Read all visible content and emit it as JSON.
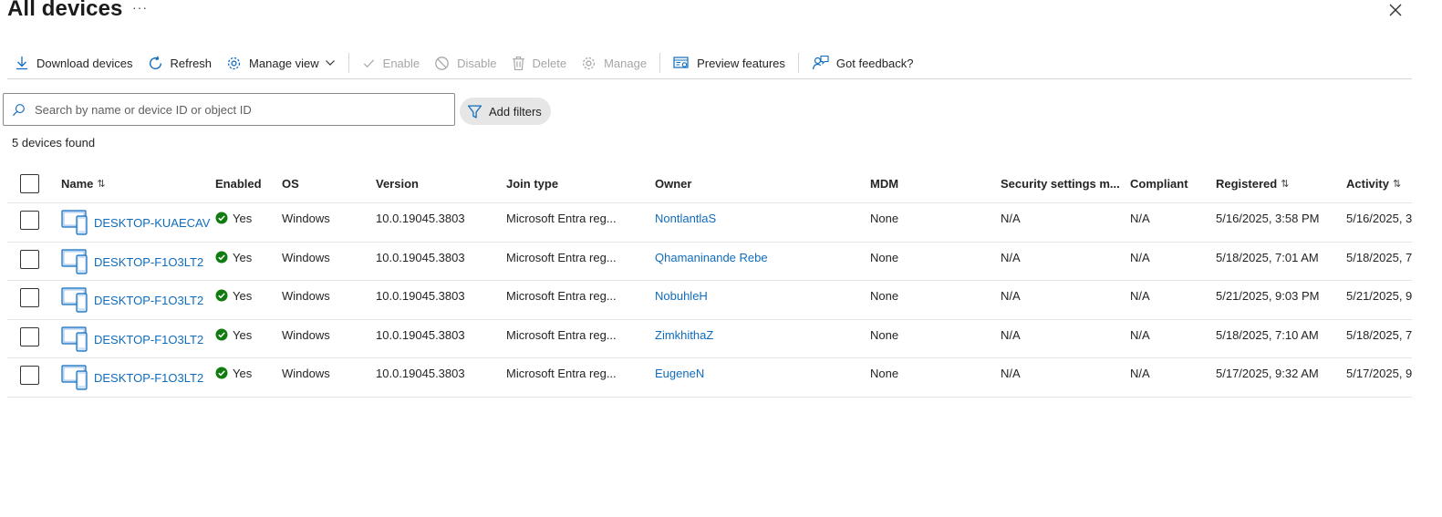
{
  "page": {
    "title": "All devices",
    "more_label": "···"
  },
  "toolbar": {
    "download_label": "Download devices",
    "refresh_label": "Refresh",
    "manage_view_label": "Manage view",
    "enable_label": "Enable",
    "disable_label": "Disable",
    "delete_label": "Delete",
    "manage_label": "Manage",
    "preview_label": "Preview features",
    "feedback_label": "Got feedback?"
  },
  "search": {
    "placeholder": "Search by name or device ID or object ID",
    "value": ""
  },
  "filters": {
    "add_label": "Add filters"
  },
  "results": {
    "count_text": "5 devices found"
  },
  "table": {
    "columns": {
      "name": "Name",
      "enabled": "Enabled",
      "os": "OS",
      "version": "Version",
      "join_type": "Join type",
      "owner": "Owner",
      "mdm": "MDM",
      "security": "Security settings m...",
      "compliant": "Compliant",
      "registered": "Registered",
      "activity": "Activity"
    },
    "sort_glyph": "⇅",
    "rows": [
      {
        "name": "DESKTOP-KUAECAV",
        "enabled": "Yes",
        "os": "Windows",
        "version": "10.0.19045.3803",
        "join_type": "Microsoft Entra reg...",
        "owner": "NontlantlaS",
        "mdm": "None",
        "security": "N/A",
        "compliant": "N/A",
        "registered": "5/16/2025, 3:58 PM",
        "activity": "5/16/2025, 3"
      },
      {
        "name": "DESKTOP-F1O3LT2",
        "enabled": "Yes",
        "os": "Windows",
        "version": "10.0.19045.3803",
        "join_type": "Microsoft Entra reg...",
        "owner": "Qhamaninande Rebe",
        "mdm": "None",
        "security": "N/A",
        "compliant": "N/A",
        "registered": "5/18/2025, 7:01 AM",
        "activity": "5/18/2025, 7"
      },
      {
        "name": "DESKTOP-F1O3LT2",
        "enabled": "Yes",
        "os": "Windows",
        "version": "10.0.19045.3803",
        "join_type": "Microsoft Entra reg...",
        "owner": "NobuhleH",
        "mdm": "None",
        "security": "N/A",
        "compliant": "N/A",
        "registered": "5/21/2025, 9:03 PM",
        "activity": "5/21/2025, 9"
      },
      {
        "name": "DESKTOP-F1O3LT2",
        "enabled": "Yes",
        "os": "Windows",
        "version": "10.0.19045.3803",
        "join_type": "Microsoft Entra reg...",
        "owner": "ZimkhithaZ",
        "mdm": "None",
        "security": "N/A",
        "compliant": "N/A",
        "registered": "5/18/2025, 7:10 AM",
        "activity": "5/18/2025, 7"
      },
      {
        "name": "DESKTOP-F1O3LT2",
        "enabled": "Yes",
        "os": "Windows",
        "version": "10.0.19045.3803",
        "join_type": "Microsoft Entra reg...",
        "owner": "EugeneN",
        "mdm": "None",
        "security": "N/A",
        "compliant": "N/A",
        "registered": "5/17/2025, 9:32 AM",
        "activity": "5/17/2025, 9"
      }
    ]
  },
  "icons": {
    "more": "more-icon",
    "close": "close-icon",
    "download": "download-icon",
    "refresh": "refresh-icon",
    "manage_view": "gear-icon",
    "enable": "checkmark-icon",
    "disable": "block-icon",
    "delete": "trash-icon",
    "manage": "gear-icon",
    "preview": "preview-icon",
    "feedback": "feedback-icon",
    "search": "search-icon",
    "filter": "filter-icon",
    "device": "device-icon",
    "enabled_status": "check-circle-icon",
    "sort": "sort-icon"
  },
  "colors": {
    "link": "#0f6cbd",
    "enabled_green": "#107c10",
    "device_icon": "#0f6cbd",
    "disabled_text": "#a6a6a6"
  }
}
